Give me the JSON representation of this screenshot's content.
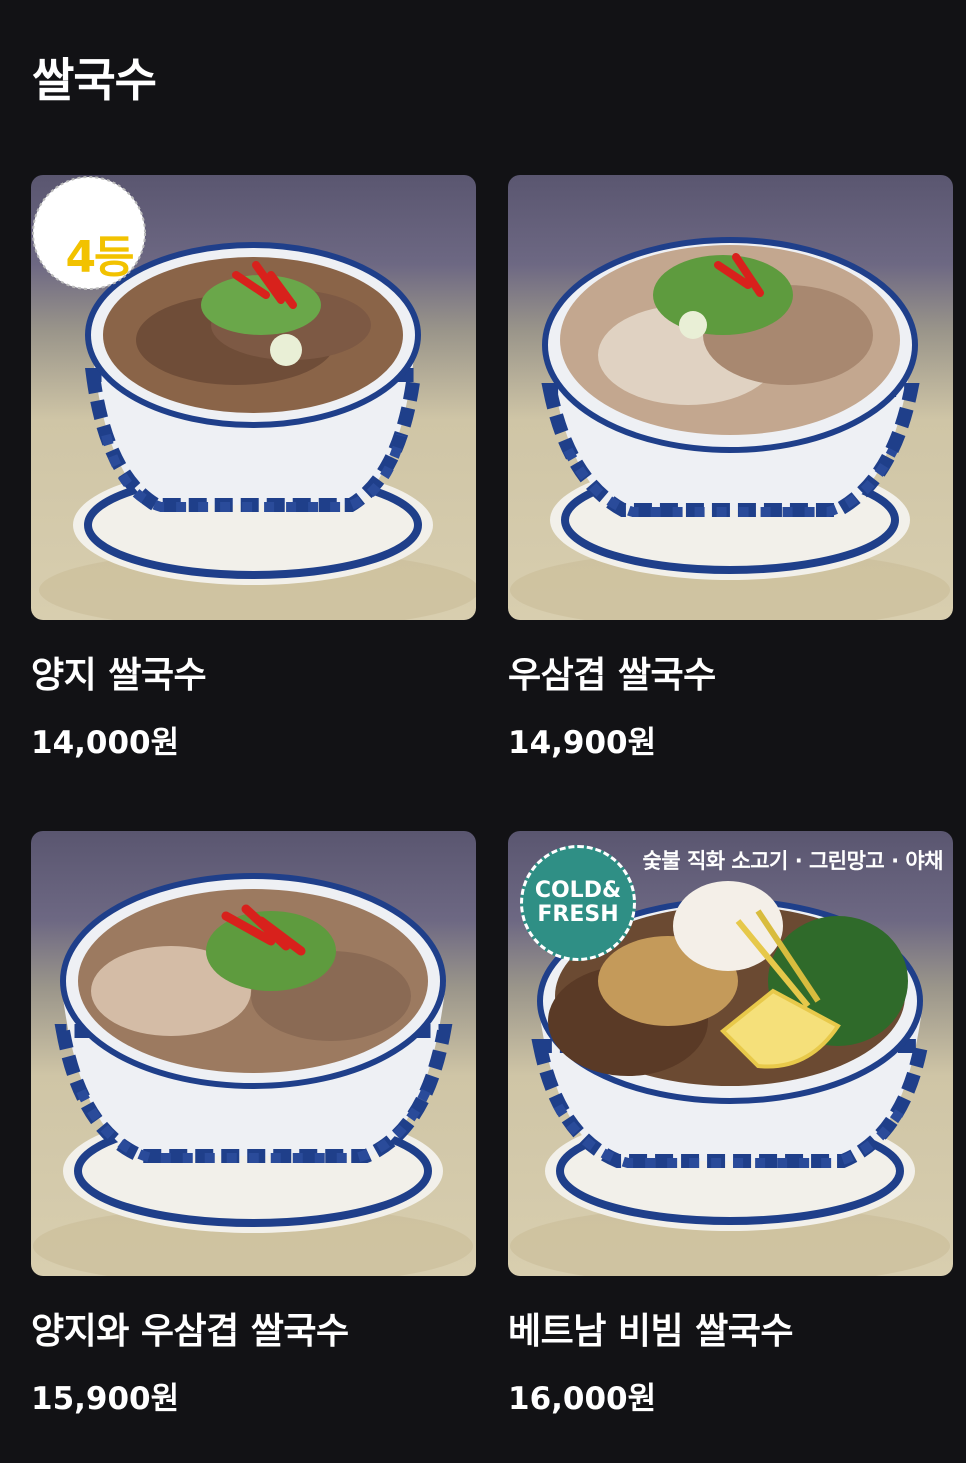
{
  "section": {
    "title": "쌀국수"
  },
  "menu": [
    {
      "name": "양지 쌀국수",
      "price": "14,000원",
      "badge": "4등",
      "photo_icon": "beef-brisket-pho-bowl"
    },
    {
      "name": "우삼겹 쌀국수",
      "price": "14,900원",
      "photo_icon": "beef-belly-pho-bowl"
    },
    {
      "name": "양지와 우삼겹 쌀국수",
      "price": "15,900원",
      "photo_icon": "combo-pho-bowl"
    },
    {
      "name": "베트남 비빔 쌀국수",
      "price": "16,000원",
      "badge_line1": "COLD&",
      "badge_line2": "FRESH",
      "banner": "숯불 직화 소고기 · 그린망고 · 야채",
      "photo_icon": "bibim-noodle-bowl"
    }
  ],
  "colors": {
    "background": "#121215",
    "text": "#ffffff",
    "rank_badge": "#f2c200",
    "fresh_badge": "#2f8f85",
    "bowl_blue": "#1f3f8a"
  }
}
